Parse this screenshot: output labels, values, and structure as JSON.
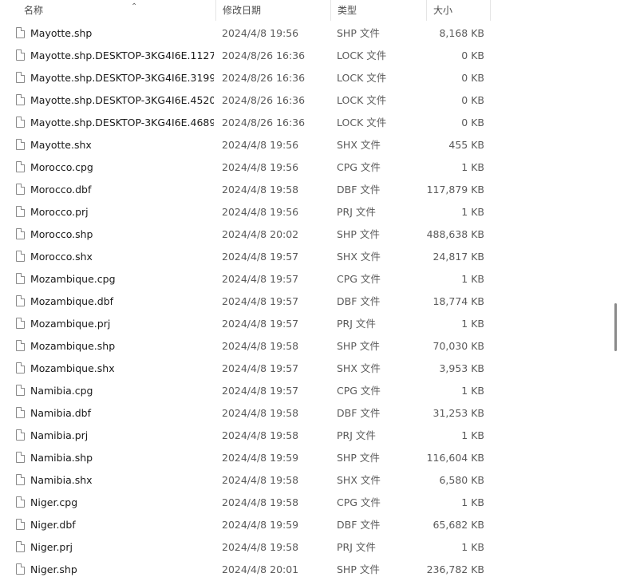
{
  "columns": {
    "name": "名称",
    "date": "修改日期",
    "type": "类型",
    "size": "大小"
  },
  "files": [
    {
      "name": "Mayotte.shp",
      "date": "2024/4/8 19:56",
      "type": "SHP 文件",
      "size": "8,168 KB"
    },
    {
      "name": "Mayotte.shp.DESKTOP-3KG4I6E.1127...",
      "date": "2024/8/26 16:36",
      "type": "LOCK 文件",
      "size": "0 KB"
    },
    {
      "name": "Mayotte.shp.DESKTOP-3KG4I6E.3199...",
      "date": "2024/8/26 16:36",
      "type": "LOCK 文件",
      "size": "0 KB"
    },
    {
      "name": "Mayotte.shp.DESKTOP-3KG4I6E.4520...",
      "date": "2024/8/26 16:36",
      "type": "LOCK 文件",
      "size": "0 KB"
    },
    {
      "name": "Mayotte.shp.DESKTOP-3KG4I6E.4689...",
      "date": "2024/8/26 16:36",
      "type": "LOCK 文件",
      "size": "0 KB"
    },
    {
      "name": "Mayotte.shx",
      "date": "2024/4/8 19:56",
      "type": "SHX 文件",
      "size": "455 KB"
    },
    {
      "name": "Morocco.cpg",
      "date": "2024/4/8 19:56",
      "type": "CPG 文件",
      "size": "1 KB"
    },
    {
      "name": "Morocco.dbf",
      "date": "2024/4/8 19:58",
      "type": "DBF 文件",
      "size": "117,879 KB"
    },
    {
      "name": "Morocco.prj",
      "date": "2024/4/8 19:56",
      "type": "PRJ 文件",
      "size": "1 KB"
    },
    {
      "name": "Morocco.shp",
      "date": "2024/4/8 20:02",
      "type": "SHP 文件",
      "size": "488,638 KB"
    },
    {
      "name": "Morocco.shx",
      "date": "2024/4/8 19:57",
      "type": "SHX 文件",
      "size": "24,817 KB"
    },
    {
      "name": "Mozambique.cpg",
      "date": "2024/4/8 19:57",
      "type": "CPG 文件",
      "size": "1 KB"
    },
    {
      "name": "Mozambique.dbf",
      "date": "2024/4/8 19:57",
      "type": "DBF 文件",
      "size": "18,774 KB"
    },
    {
      "name": "Mozambique.prj",
      "date": "2024/4/8 19:57",
      "type": "PRJ 文件",
      "size": "1 KB"
    },
    {
      "name": "Mozambique.shp",
      "date": "2024/4/8 19:58",
      "type": "SHP 文件",
      "size": "70,030 KB"
    },
    {
      "name": "Mozambique.shx",
      "date": "2024/4/8 19:57",
      "type": "SHX 文件",
      "size": "3,953 KB"
    },
    {
      "name": "Namibia.cpg",
      "date": "2024/4/8 19:57",
      "type": "CPG 文件",
      "size": "1 KB"
    },
    {
      "name": "Namibia.dbf",
      "date": "2024/4/8 19:58",
      "type": "DBF 文件",
      "size": "31,253 KB"
    },
    {
      "name": "Namibia.prj",
      "date": "2024/4/8 19:58",
      "type": "PRJ 文件",
      "size": "1 KB"
    },
    {
      "name": "Namibia.shp",
      "date": "2024/4/8 19:59",
      "type": "SHP 文件",
      "size": "116,604 KB"
    },
    {
      "name": "Namibia.shx",
      "date": "2024/4/8 19:58",
      "type": "SHX 文件",
      "size": "6,580 KB"
    },
    {
      "name": "Niger.cpg",
      "date": "2024/4/8 19:58",
      "type": "CPG 文件",
      "size": "1 KB"
    },
    {
      "name": "Niger.dbf",
      "date": "2024/4/8 19:59",
      "type": "DBF 文件",
      "size": "65,682 KB"
    },
    {
      "name": "Niger.prj",
      "date": "2024/4/8 19:58",
      "type": "PRJ 文件",
      "size": "1 KB"
    },
    {
      "name": "Niger.shp",
      "date": "2024/4/8 20:01",
      "type": "SHP 文件",
      "size": "236,782 KB"
    }
  ]
}
